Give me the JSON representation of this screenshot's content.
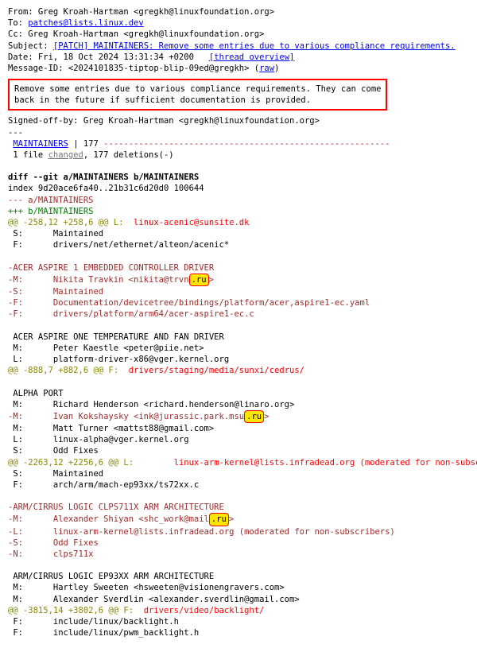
{
  "header": {
    "from_label": "From:",
    "from_value": " Greg Kroah-Hartman <gregkh@linuxfoundation.org>",
    "to_label": "To:",
    "to_link": "patches@lists.linux.dev",
    "cc_label": "Cc:",
    "cc_value": " Greg Kroah-Hartman <gregkh@linuxfoundation.org>",
    "subject_label": "Subject:",
    "subject_value": "[PATCH] MAINTAINERS: Remove some entries due to various compliance requirements.",
    "date_label": "Date:",
    "date_value": " Fri, 18 Oct 2024 13:31:34 +0200",
    "thread_link": "[thread overview]",
    "msgid_label": "Message-ID:",
    "msgid_value": " <2024101835-tiptop-blip-09ed@gregkh>",
    "raw_link": "raw"
  },
  "message": {
    "body": "Remove some entries due to various compliance requirements. They can come\nback in the future if sufficient documentation is provided."
  },
  "signoff": {
    "line": "Signed-off-by: Greg Kroah-Hartman <gregkh@linuxfoundation.org>",
    "sep": "---"
  },
  "diffstat": {
    "file": "MAINTAINERS",
    "bar_pre": " | 177 ",
    "bar": "---------------------------------------------------------",
    "summary_pre": " 1 file ",
    "changed": "changed",
    "summary_post": ", 177 deletions(-)"
  },
  "diff": {
    "cmd": "diff --git a/MAINTAINERS b/MAINTAINERS",
    "index": "index 9d20ace6fa40..21b31c6d20d0 100644",
    "a": "--- a/MAINTAINERS",
    "b": "+++ b/MAINTAINERS"
  },
  "hunks": [
    {
      "head": "@@ -258,12 +258,6 @@ L:",
      "tail": "  linux-acenic@sunsite.dk",
      "ctx": [
        " S:      Maintained",
        " F:      drivers/net/ethernet/alteon/acenic*",
        " "
      ],
      "del": [
        {
          "pre": "-ACER ASPIRE 1 EMBEDDED CONTROLLER DRIVER"
        },
        {
          "pre": "-M:      Nikita Travkin <nikita@trvn",
          "ru": ".ru",
          "post": ">"
        },
        {
          "pre": "-S:      Maintained"
        },
        {
          "pre": "-F:      Documentation/devicetree/bindings/platform/acer,aspire1-ec.yaml"
        },
        {
          "pre": "-F:      drivers/platform/arm64/acer-aspire1-ec.c"
        }
      ],
      "after_ctx": [
        " ",
        " ACER ASPIRE ONE TEMPERATURE AND FAN DRIVER",
        " M:      Peter Kaestle <peter@piie.net>",
        " L:      platform-driver-x86@vger.kernel.org"
      ]
    },
    {
      "head": "@@ -888,7 +882,6 @@ F:",
      "tail": "  drivers/staging/media/sunxi/cedrus/",
      "ctx": [
        " ",
        " ALPHA PORT",
        " M:      Richard Henderson <richard.henderson@linaro.org>"
      ],
      "del": [
        {
          "pre": "-M:      Ivan Kokshaysky <ink@jurassic.park.msu",
          "ru": ".ru",
          "post": ">"
        }
      ],
      "after_ctx": [
        " M:      Matt Turner <mattst88@gmail.com>",
        " L:      linux-alpha@vger.kernel.org",
        " S:      Odd Fixes"
      ]
    },
    {
      "head": "@@ -2263,12 +2256,6 @@ L:",
      "tail": "        linux-arm-kernel@lists.infradead.org (moderated for non-subscribers)",
      "ctx": [
        " S:      Maintained",
        " F:      arch/arm/mach-ep93xx/ts72xx.c",
        " "
      ],
      "del": [
        {
          "pre": "-ARM/CIRRUS LOGIC CLPS711X ARM ARCHITECTURE"
        },
        {
          "pre": "-M:      Alexander Shiyan <shc_work@mail",
          "ru": ".ru",
          "post": ">"
        },
        {
          "pre": "-L:      linux-arm-kernel@lists.infradead.org (moderated for non-subscribers)"
        },
        {
          "pre": "-S:      Odd Fixes"
        },
        {
          "pre": "-N:      clps711x"
        }
      ],
      "after_ctx": [
        " ",
        " ARM/CIRRUS LOGIC EP93XX ARM ARCHITECTURE",
        " M:      Hartley Sweeten <hsweeten@visionengravers.com>",
        " M:      Alexander Sverdlin <alexander.sverdlin@gmail.com>"
      ]
    },
    {
      "head": "@@ -3815,14 +3802,6 @@ F:",
      "tail": "  drivers/video/backlight/",
      "ctx": [],
      "del": [],
      "after_ctx": [
        " F:      include/linux/backlight.h",
        " F:      include/linux/pwm_backlight.h"
      ]
    }
  ]
}
